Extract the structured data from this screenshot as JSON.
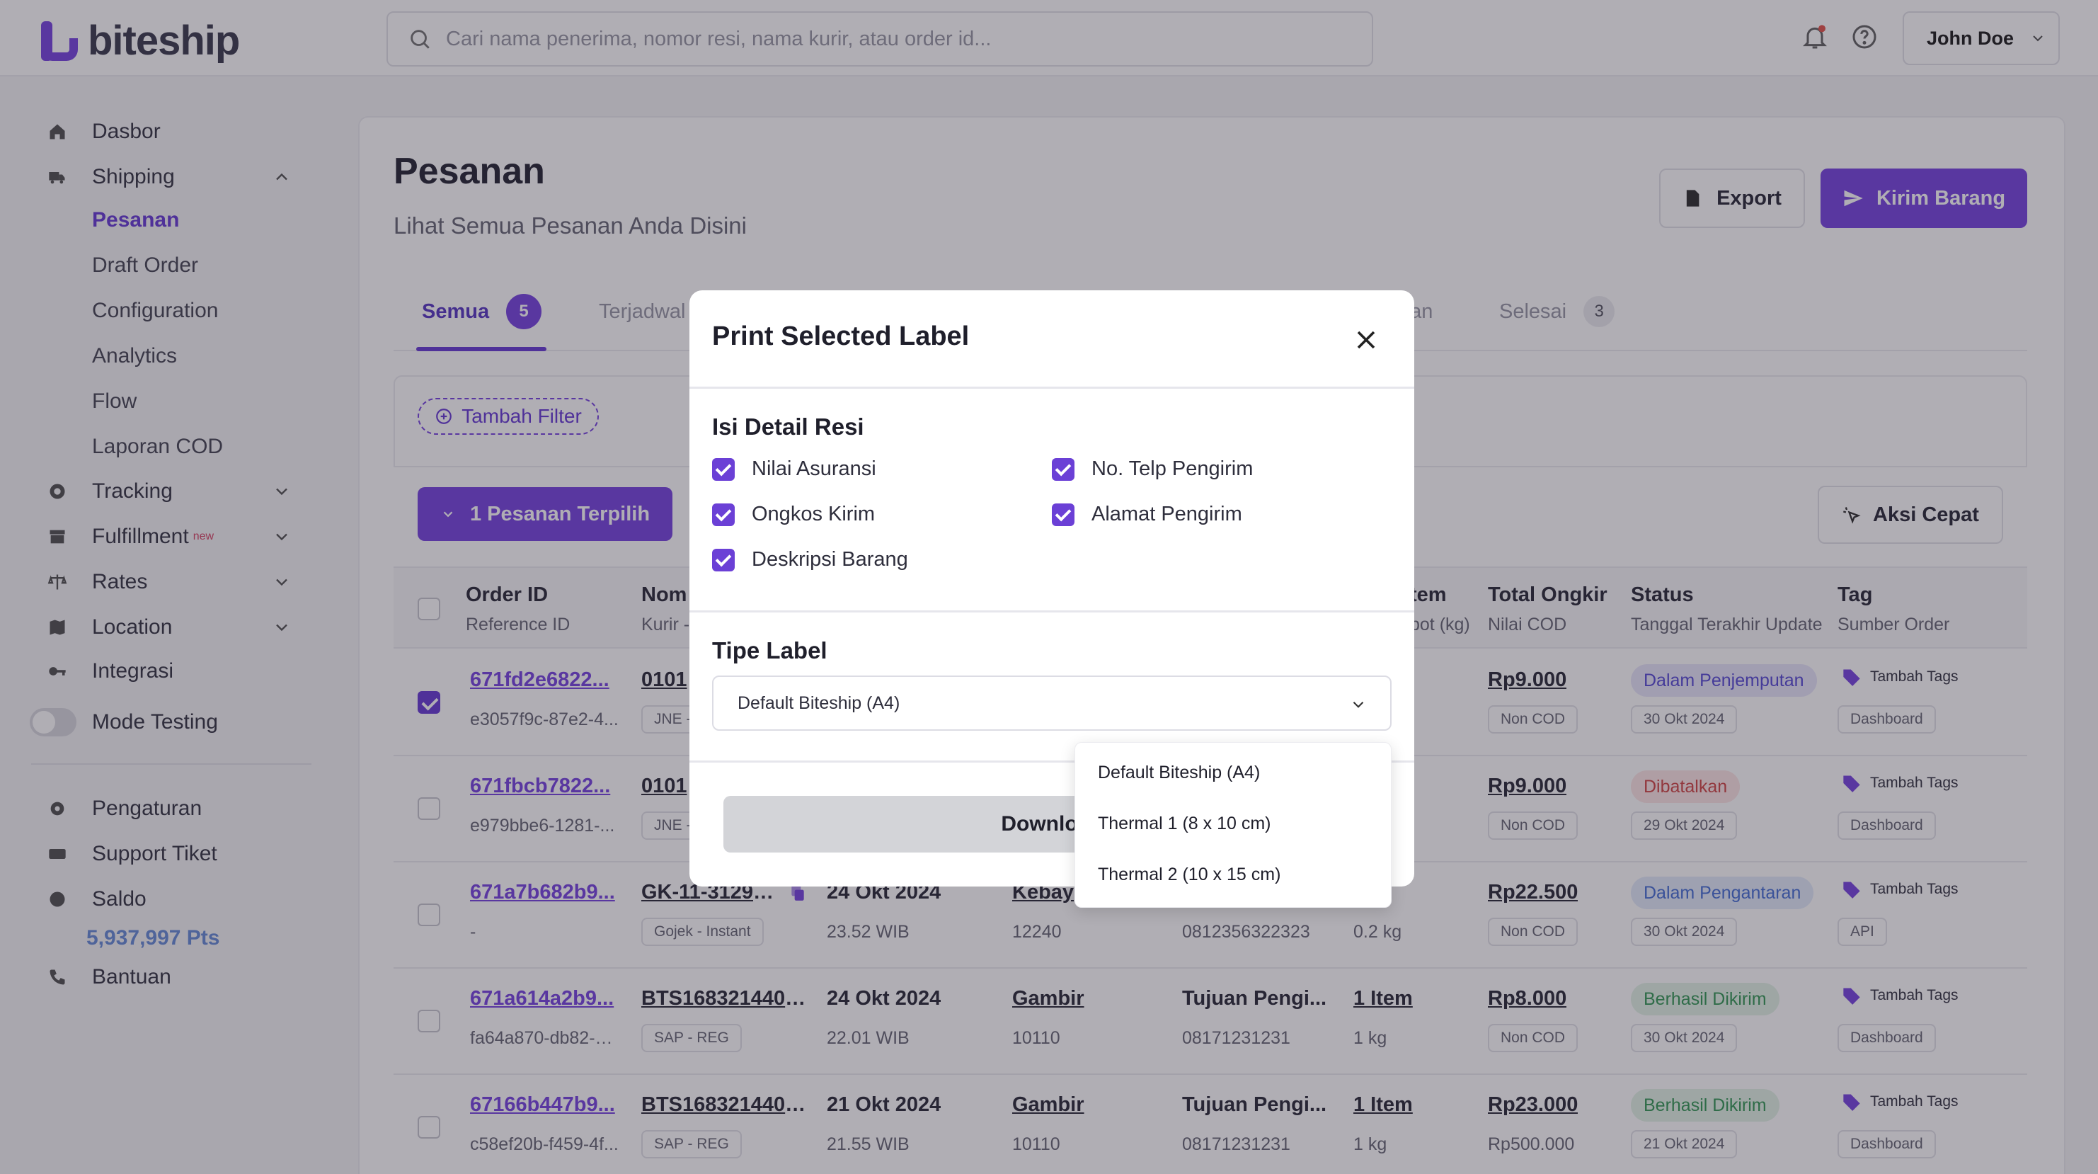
{
  "app": {
    "brand": "biteship"
  },
  "header": {
    "search_placeholder": "Cari nama penerima, nomor resi, nama kurir, atau order id...",
    "user_name": "John Doe"
  },
  "sidebar": {
    "items": [
      {
        "label": "Dasbor",
        "icon": "home-icon"
      },
      {
        "label": "Shipping",
        "icon": "truck-icon"
      },
      {
        "label": "Tracking",
        "icon": "tracking-icon"
      },
      {
        "label": "Fulfillment",
        "icon": "box-icon",
        "badge": "new"
      },
      {
        "label": "Rates",
        "icon": "scale-icon"
      },
      {
        "label": "Location",
        "icon": "map-icon"
      },
      {
        "label": "Integrasi",
        "icon": "key-icon"
      },
      {
        "label": "Mode Testing",
        "icon": "toggle-icon"
      },
      {
        "label": "Pengaturan",
        "icon": "gear-icon"
      },
      {
        "label": "Support Tiket",
        "icon": "ticket-icon"
      },
      {
        "label": "Saldo",
        "icon": "coin-icon"
      },
      {
        "label": "Bantuan",
        "icon": "phone-icon"
      }
    ],
    "shipping_sub": [
      "Pesanan",
      "Draft Order",
      "Configuration",
      "Analytics",
      "Flow",
      "Laporan COD"
    ],
    "points": "5,937,997 Pts"
  },
  "page": {
    "title": "Pesanan",
    "subtitle": "Lihat Semua Pesanan Anda Disini",
    "export_label": "Export",
    "kirim_label": "Kirim Barang",
    "tabs": [
      {
        "label": "Semua",
        "count": "5"
      },
      {
        "label": "Terjadwal"
      },
      {
        "label": "nan"
      },
      {
        "label": "Selesai",
        "count": "3"
      }
    ],
    "filter_label": "Tambah Filter",
    "selected_label": "1 Pesanan Terpilih",
    "aksi_label": "Aksi Cepat"
  },
  "table": {
    "headers": [
      {
        "title": "Order ID",
        "sub": "Reference ID"
      },
      {
        "title": "Nom",
        "sub": "Kurir -"
      },
      {
        "title": "tem",
        "sub": "bot (kg)"
      },
      {
        "title": "Total Ongkir",
        "sub": "Nilai COD"
      },
      {
        "title": "Status",
        "sub": "Tanggal Terakhir Update"
      },
      {
        "title": "Tag",
        "sub": "Sumber Order"
      }
    ],
    "rows": [
      {
        "order_id": "671fd2e6822...",
        "ref": "e3057f9c-87e2-4...",
        "resi": "0101",
        "kurir": "JNE -",
        "date": "",
        "time": "",
        "area": "",
        "zip": "",
        "recv": "",
        "phone": "",
        "item": "",
        "weight": "",
        "ongkir": "Rp9.000",
        "cod": "Non COD",
        "status": "Dalam Penjemputan",
        "status_date": "30 Okt 2024",
        "tag": "Tambah Tags",
        "source": "Dashboard"
      },
      {
        "order_id": "671fbcb7822...",
        "ref": "e979bbe6-1281-...",
        "resi": "0101",
        "kurir": "JNE -",
        "date": "",
        "time": "",
        "area": "",
        "zip": "",
        "recv": "",
        "phone": "",
        "item": "",
        "weight": "",
        "ongkir": "Rp9.000",
        "cod": "Non COD",
        "status": "Dibatalkan",
        "status_date": "29 Okt 2024",
        "tag": "Tambah Tags",
        "source": "Dashboard"
      },
      {
        "order_id": "671a7b682b9...",
        "ref": "-",
        "resi": "GK-11-3129897",
        "kurir": "Gojek - Instant",
        "date": "24 Okt 2024",
        "time": "23.52 WIB",
        "area": "Kebay",
        "zip": "12240",
        "recv": "",
        "phone": "0812356322323",
        "item": "tem",
        "weight": "0.2 kg",
        "ongkir": "Rp22.500",
        "cod": "Non COD",
        "status": "Dalam Pengantaran",
        "status_date": "30 Okt 2024",
        "tag": "Tambah Tags",
        "source": "API"
      },
      {
        "order_id": "671a614a2b9...",
        "ref": "fa64a870-db82-4...",
        "resi": "BTS168321440243",
        "kurir": "SAP - REG",
        "date": "24 Okt 2024",
        "time": "22.01 WIB",
        "area": "Gambir",
        "zip": "10110",
        "recv": "Tujuan Pengi...",
        "phone": "08171231231",
        "item": "1 Item",
        "weight": "1 kg",
        "ongkir": "Rp8.000",
        "cod": "Non COD",
        "status": "Berhasil Dikirim",
        "status_date": "30 Okt 2024",
        "tag": "Tambah Tags",
        "source": "Dashboard"
      },
      {
        "order_id": "67166b447b9...",
        "ref": "c58ef20b-f459-4f...",
        "resi": "BTS168321440238",
        "kurir": "SAP - REG",
        "date": "21 Okt 2024",
        "time": "21.55 WIB",
        "area": "Gambir",
        "zip": "10110",
        "recv": "Tujuan Pengi...",
        "phone": "08171231231",
        "item": "1 Item",
        "weight": "1 kg",
        "ongkir": "Rp23.000",
        "cod": "Rp500.000",
        "status": "Berhasil Dikirim",
        "status_date": "21 Okt 2024",
        "tag": "Tambah Tags",
        "source": "Dashboard"
      }
    ]
  },
  "modal": {
    "title": "Print Selected Label",
    "section1": "Isi Detail Resi",
    "options": [
      "Nilai Asuransi",
      "No. Telp Pengirim",
      "Ongkos Kirim",
      "Alamat Pengirim",
      "Deskripsi Barang"
    ],
    "section2": "Tipe Label",
    "selected_type": "Default Biteship (A4)",
    "download_label": "Download",
    "dropdown": [
      "Default Biteship (A4)",
      "Thermal 1 (8 x 10 cm)",
      "Thermal 2 (10 x 15 cm)"
    ]
  },
  "colors": {
    "accent": "#7a49e0",
    "accent_dark": "#6b40d6"
  }
}
